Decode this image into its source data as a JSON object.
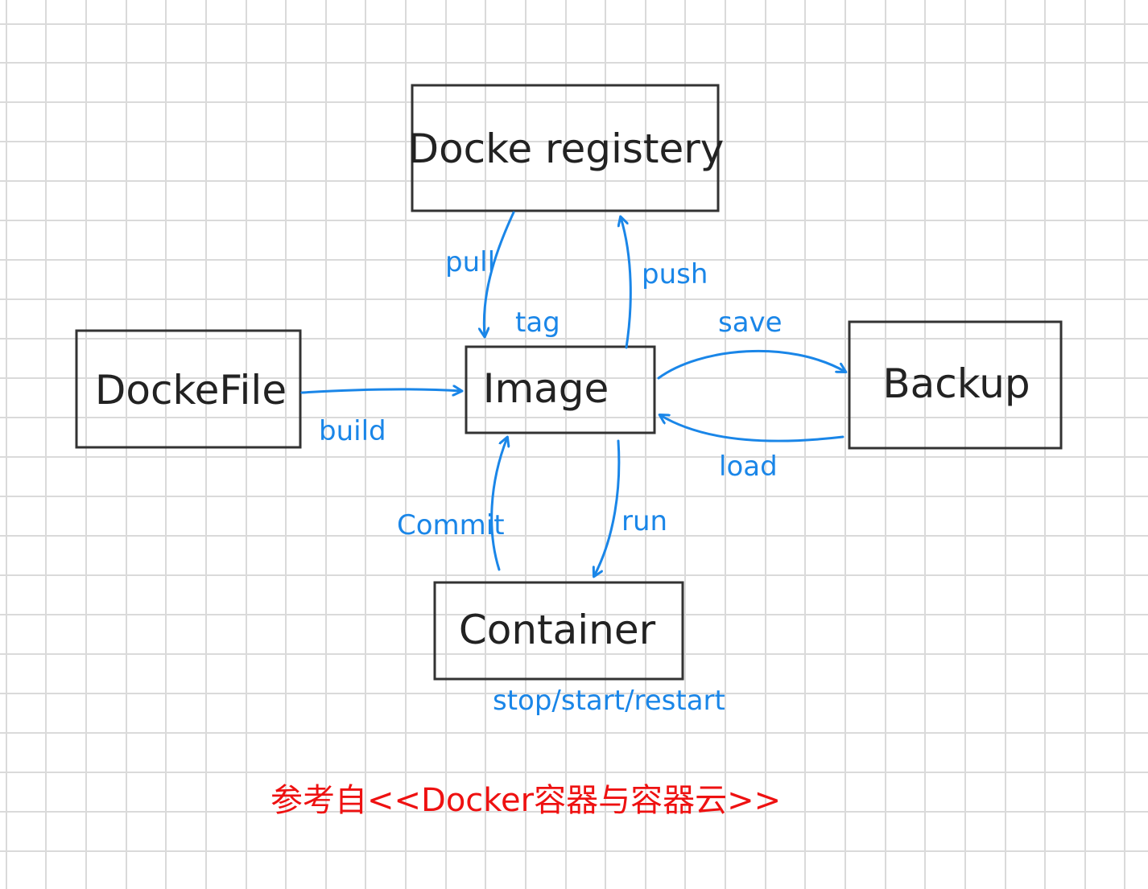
{
  "colors": {
    "grid": "#dadada",
    "box_stroke": "#333333",
    "box_text": "#222222",
    "arrow": "#1a86e8",
    "credit": "#ee1111"
  },
  "nodes": {
    "registry": "Docke registery",
    "dockerfile": "DockeFile",
    "image": "Image",
    "backup": "Backup",
    "container": "Container"
  },
  "edges": {
    "pull": "pull",
    "push": "push",
    "tag": "tag",
    "build": "build",
    "save": "save",
    "load": "load",
    "commit": "Commit",
    "run": "run"
  },
  "container_note": "stop/start/restart",
  "credit": "参考自<<Docker容器与容器云>>"
}
